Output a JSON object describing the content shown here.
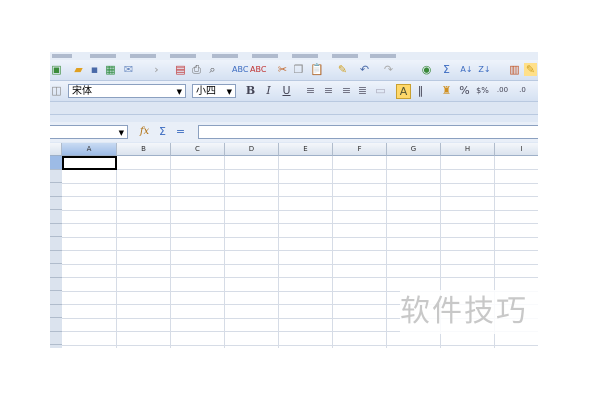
{
  "toolbar": {
    "font_name": "宋体",
    "font_size": "小四",
    "bold": "B",
    "italic": "I",
    "underline": "U",
    "percent": "%"
  },
  "formula_bar": {
    "fx": "fx",
    "sum": "Σ",
    "equals": "=",
    "value": ""
  },
  "columns": [
    "A",
    "B",
    "C",
    "D",
    "E",
    "F",
    "G",
    "H",
    "I"
  ],
  "watermark": "软件技巧"
}
